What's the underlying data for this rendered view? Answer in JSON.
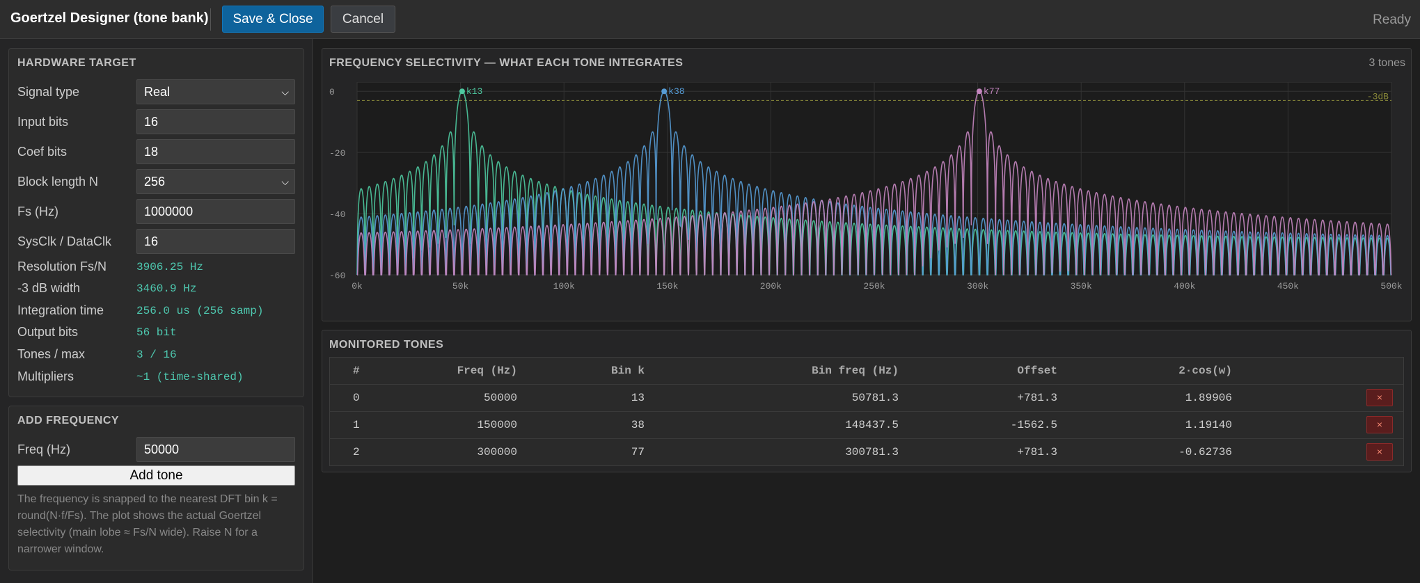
{
  "header": {
    "title": "Goertzel Designer (tone bank)",
    "save_label": "Save & Close",
    "cancel_label": "Cancel",
    "status": "Ready"
  },
  "hardware": {
    "title": "HARDWARE TARGET",
    "signal_type_label": "Signal type",
    "signal_type_value": "Real",
    "input_bits_label": "Input bits",
    "input_bits_value": "16",
    "coef_bits_label": "Coef bits",
    "coef_bits_value": "18",
    "block_length_label": "Block length N",
    "block_length_value": "256",
    "fs_label": "Fs (Hz)",
    "fs_value": "1000000",
    "sysclk_label": "SysClk / DataClk",
    "sysclk_value": "16",
    "resolution_label": "Resolution Fs/N",
    "resolution_value": "3906.25 Hz",
    "width_label": "-3 dB width",
    "width_value": "3460.9 Hz",
    "integration_label": "Integration time",
    "integration_value": "256.0 us (256 samp)",
    "output_bits_label": "Output bits",
    "output_bits_value": "56 bit",
    "tones_max_label": "Tones / max",
    "tones_max_value": "3 / 16",
    "multipliers_label": "Multipliers",
    "multipliers_value": "~1 (time-shared)"
  },
  "add_frequency": {
    "title": "ADD FREQUENCY",
    "freq_label": "Freq (Hz)",
    "freq_value": "50000",
    "add_label": "Add tone",
    "hint": "The frequency is snapped to the nearest DFT bin k = round(N·f/Fs). The plot shows the actual Goertzel selectivity (main lobe ≈ Fs/N wide). Raise N for a narrower window."
  },
  "chart_section": {
    "title": "FREQUENCY SELECTIVITY — WHAT EACH TONE INTEGRATES",
    "tone_count": "3 tones"
  },
  "chart_data": {
    "type": "line",
    "xlabel": "",
    "ylabel": "",
    "x_ticks": [
      "0k",
      "50k",
      "100k",
      "150k",
      "200k",
      "250k",
      "300k",
      "350k",
      "400k",
      "450k",
      "500k"
    ],
    "y_ticks": [
      "0",
      "-20",
      "-40",
      "-60"
    ],
    "xlim": [
      0,
      500000
    ],
    "ylim": [
      -60,
      3
    ],
    "reference_line": {
      "label": "-3dB",
      "value": -3,
      "color": "#8a8a3a"
    },
    "grid": true,
    "N": 256,
    "fs": 1000000,
    "series": [
      {
        "name": "k13",
        "bin": 13,
        "color": "#4ec9a0"
      },
      {
        "name": "k38",
        "bin": 38,
        "color": "#569cd6"
      },
      {
        "name": "k77",
        "bin": 77,
        "color": "#c586c0"
      }
    ]
  },
  "tones_section": {
    "title": "MONITORED TONES",
    "columns": [
      "#",
      "Freq (Hz)",
      "Bin k",
      "Bin freq (Hz)",
      "Offset",
      "2·cos(w)"
    ],
    "delete_symbol": "×",
    "rows": [
      {
        "index": "0",
        "freq": "50000",
        "bin": "13",
        "bin_freq": "50781.3",
        "offset": "+781.3",
        "coef": "1.89906"
      },
      {
        "index": "1",
        "freq": "150000",
        "bin": "38",
        "bin_freq": "148437.5",
        "offset": "-1562.5",
        "coef": "1.19140"
      },
      {
        "index": "2",
        "freq": "300000",
        "bin": "77",
        "bin_freq": "300781.3",
        "offset": "+781.3",
        "coef": "-0.62736"
      }
    ]
  }
}
